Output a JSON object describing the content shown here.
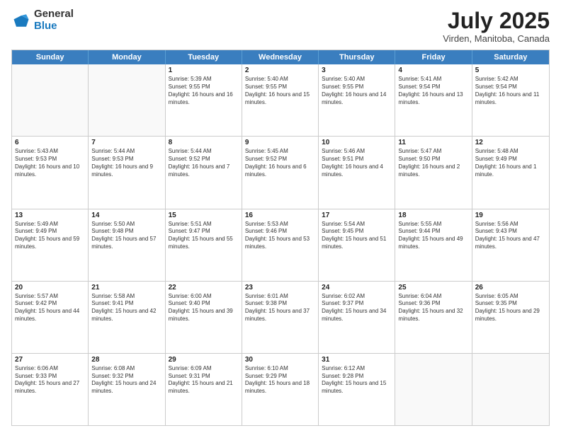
{
  "logo": {
    "general": "General",
    "blue": "Blue"
  },
  "title": "July 2025",
  "location": "Virden, Manitoba, Canada",
  "header_days": [
    "Sunday",
    "Monday",
    "Tuesday",
    "Wednesday",
    "Thursday",
    "Friday",
    "Saturday"
  ],
  "weeks": [
    [
      {
        "day": "",
        "sunrise": "",
        "sunset": "",
        "daylight": "",
        "empty": true
      },
      {
        "day": "",
        "sunrise": "",
        "sunset": "",
        "daylight": "",
        "empty": true
      },
      {
        "day": "1",
        "sunrise": "Sunrise: 5:39 AM",
        "sunset": "Sunset: 9:55 PM",
        "daylight": "Daylight: 16 hours and 16 minutes.",
        "empty": false
      },
      {
        "day": "2",
        "sunrise": "Sunrise: 5:40 AM",
        "sunset": "Sunset: 9:55 PM",
        "daylight": "Daylight: 16 hours and 15 minutes.",
        "empty": false
      },
      {
        "day": "3",
        "sunrise": "Sunrise: 5:40 AM",
        "sunset": "Sunset: 9:55 PM",
        "daylight": "Daylight: 16 hours and 14 minutes.",
        "empty": false
      },
      {
        "day": "4",
        "sunrise": "Sunrise: 5:41 AM",
        "sunset": "Sunset: 9:54 PM",
        "daylight": "Daylight: 16 hours and 13 minutes.",
        "empty": false
      },
      {
        "day": "5",
        "sunrise": "Sunrise: 5:42 AM",
        "sunset": "Sunset: 9:54 PM",
        "daylight": "Daylight: 16 hours and 11 minutes.",
        "empty": false
      }
    ],
    [
      {
        "day": "6",
        "sunrise": "Sunrise: 5:43 AM",
        "sunset": "Sunset: 9:53 PM",
        "daylight": "Daylight: 16 hours and 10 minutes.",
        "empty": false
      },
      {
        "day": "7",
        "sunrise": "Sunrise: 5:44 AM",
        "sunset": "Sunset: 9:53 PM",
        "daylight": "Daylight: 16 hours and 9 minutes.",
        "empty": false
      },
      {
        "day": "8",
        "sunrise": "Sunrise: 5:44 AM",
        "sunset": "Sunset: 9:52 PM",
        "daylight": "Daylight: 16 hours and 7 minutes.",
        "empty": false
      },
      {
        "day": "9",
        "sunrise": "Sunrise: 5:45 AM",
        "sunset": "Sunset: 9:52 PM",
        "daylight": "Daylight: 16 hours and 6 minutes.",
        "empty": false
      },
      {
        "day": "10",
        "sunrise": "Sunrise: 5:46 AM",
        "sunset": "Sunset: 9:51 PM",
        "daylight": "Daylight: 16 hours and 4 minutes.",
        "empty": false
      },
      {
        "day": "11",
        "sunrise": "Sunrise: 5:47 AM",
        "sunset": "Sunset: 9:50 PM",
        "daylight": "Daylight: 16 hours and 2 minutes.",
        "empty": false
      },
      {
        "day": "12",
        "sunrise": "Sunrise: 5:48 AM",
        "sunset": "Sunset: 9:49 PM",
        "daylight": "Daylight: 16 hours and 1 minute.",
        "empty": false
      }
    ],
    [
      {
        "day": "13",
        "sunrise": "Sunrise: 5:49 AM",
        "sunset": "Sunset: 9:49 PM",
        "daylight": "Daylight: 15 hours and 59 minutes.",
        "empty": false
      },
      {
        "day": "14",
        "sunrise": "Sunrise: 5:50 AM",
        "sunset": "Sunset: 9:48 PM",
        "daylight": "Daylight: 15 hours and 57 minutes.",
        "empty": false
      },
      {
        "day": "15",
        "sunrise": "Sunrise: 5:51 AM",
        "sunset": "Sunset: 9:47 PM",
        "daylight": "Daylight: 15 hours and 55 minutes.",
        "empty": false
      },
      {
        "day": "16",
        "sunrise": "Sunrise: 5:53 AM",
        "sunset": "Sunset: 9:46 PM",
        "daylight": "Daylight: 15 hours and 53 minutes.",
        "empty": false
      },
      {
        "day": "17",
        "sunrise": "Sunrise: 5:54 AM",
        "sunset": "Sunset: 9:45 PM",
        "daylight": "Daylight: 15 hours and 51 minutes.",
        "empty": false
      },
      {
        "day": "18",
        "sunrise": "Sunrise: 5:55 AM",
        "sunset": "Sunset: 9:44 PM",
        "daylight": "Daylight: 15 hours and 49 minutes.",
        "empty": false
      },
      {
        "day": "19",
        "sunrise": "Sunrise: 5:56 AM",
        "sunset": "Sunset: 9:43 PM",
        "daylight": "Daylight: 15 hours and 47 minutes.",
        "empty": false
      }
    ],
    [
      {
        "day": "20",
        "sunrise": "Sunrise: 5:57 AM",
        "sunset": "Sunset: 9:42 PM",
        "daylight": "Daylight: 15 hours and 44 minutes.",
        "empty": false
      },
      {
        "day": "21",
        "sunrise": "Sunrise: 5:58 AM",
        "sunset": "Sunset: 9:41 PM",
        "daylight": "Daylight: 15 hours and 42 minutes.",
        "empty": false
      },
      {
        "day": "22",
        "sunrise": "Sunrise: 6:00 AM",
        "sunset": "Sunset: 9:40 PM",
        "daylight": "Daylight: 15 hours and 39 minutes.",
        "empty": false
      },
      {
        "day": "23",
        "sunrise": "Sunrise: 6:01 AM",
        "sunset": "Sunset: 9:38 PM",
        "daylight": "Daylight: 15 hours and 37 minutes.",
        "empty": false
      },
      {
        "day": "24",
        "sunrise": "Sunrise: 6:02 AM",
        "sunset": "Sunset: 9:37 PM",
        "daylight": "Daylight: 15 hours and 34 minutes.",
        "empty": false
      },
      {
        "day": "25",
        "sunrise": "Sunrise: 6:04 AM",
        "sunset": "Sunset: 9:36 PM",
        "daylight": "Daylight: 15 hours and 32 minutes.",
        "empty": false
      },
      {
        "day": "26",
        "sunrise": "Sunrise: 6:05 AM",
        "sunset": "Sunset: 9:35 PM",
        "daylight": "Daylight: 15 hours and 29 minutes.",
        "empty": false
      }
    ],
    [
      {
        "day": "27",
        "sunrise": "Sunrise: 6:06 AM",
        "sunset": "Sunset: 9:33 PM",
        "daylight": "Daylight: 15 hours and 27 minutes.",
        "empty": false
      },
      {
        "day": "28",
        "sunrise": "Sunrise: 6:08 AM",
        "sunset": "Sunset: 9:32 PM",
        "daylight": "Daylight: 15 hours and 24 minutes.",
        "empty": false
      },
      {
        "day": "29",
        "sunrise": "Sunrise: 6:09 AM",
        "sunset": "Sunset: 9:31 PM",
        "daylight": "Daylight: 15 hours and 21 minutes.",
        "empty": false
      },
      {
        "day": "30",
        "sunrise": "Sunrise: 6:10 AM",
        "sunset": "Sunset: 9:29 PM",
        "daylight": "Daylight: 15 hours and 18 minutes.",
        "empty": false
      },
      {
        "day": "31",
        "sunrise": "Sunrise: 6:12 AM",
        "sunset": "Sunset: 9:28 PM",
        "daylight": "Daylight: 15 hours and 15 minutes.",
        "empty": false
      },
      {
        "day": "",
        "sunrise": "",
        "sunset": "",
        "daylight": "",
        "empty": true
      },
      {
        "day": "",
        "sunrise": "",
        "sunset": "",
        "daylight": "",
        "empty": true
      }
    ]
  ]
}
